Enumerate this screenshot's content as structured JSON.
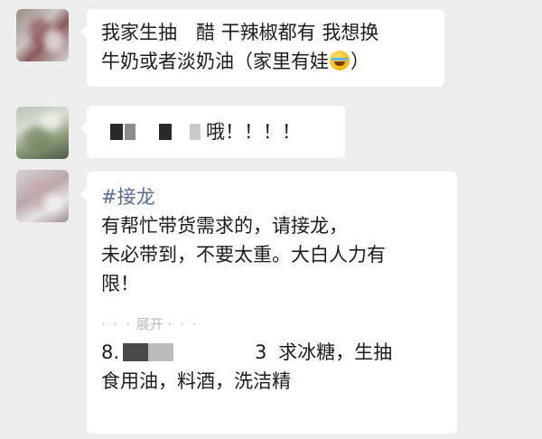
{
  "messages": [
    {
      "avatar": "user-avatar-blurred-1",
      "lines": [
        "我家生抽　醋 干辣椒都有 我想换",
        "牛奶或者淡奶油（家里有娃",
        "）"
      ],
      "emoji": "laughing-crying-emoji"
    },
    {
      "avatar": "user-avatar-blurred-2",
      "text": "哦！！！！"
    },
    {
      "avatar": "user-avatar-blurred-3",
      "hashtag": "#接龙",
      "lines": [
        "有帮忙带货需求的，请接龙，",
        "未必带到，不要太重。大白人力有",
        "限！"
      ],
      "expand_label": "展开",
      "expand_dots_left": "· · ·",
      "expand_dots_right": "· · ·",
      "list_item_prefix": "8.",
      "list_item_tail": "3",
      "list_item_text_1": "求冰糖，生抽",
      "list_item_text_2": "食用油，料酒，洗洁精"
    }
  ],
  "colors": {
    "background": "#ededed",
    "bubble": "#ffffff",
    "hashtag": "#576b95",
    "expand": "#9aa3b5"
  }
}
